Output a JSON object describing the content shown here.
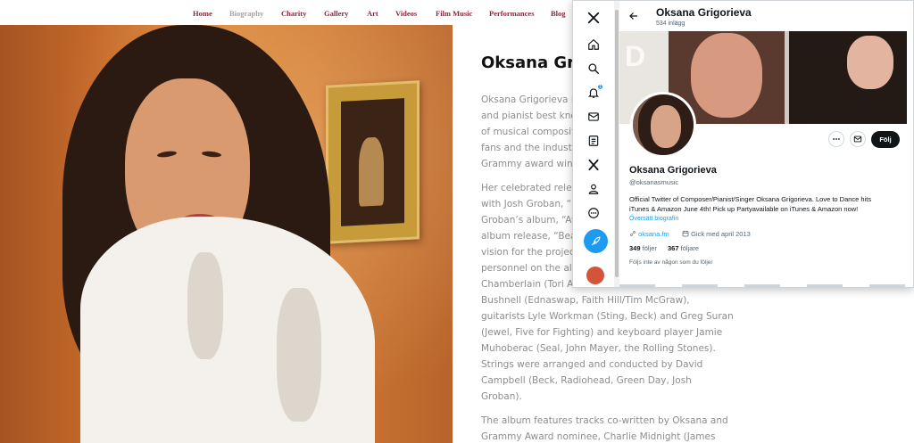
{
  "site_nav": {
    "items": [
      {
        "label": "Home"
      },
      {
        "label": "Biography"
      },
      {
        "label": "Charity"
      },
      {
        "label": "Gallery"
      },
      {
        "label": "Art"
      },
      {
        "label": "Videos"
      },
      {
        "label": "Film Music"
      },
      {
        "label": "Performances"
      },
      {
        "label": "Blog"
      }
    ]
  },
  "article": {
    "title": "Oksana Grig",
    "lines": [
      "Oksana Grigorieva is",
      "and pianist best know",
      "of musical compositio",
      "fans and the industry",
      "Grammy award winni",
      "Her celebrated relea",
      "with Josh Groban, “u",
      "Groban’s album, “Awa",
      "album release, “Beau",
      "vision for the project,",
      "personnel on the albu",
      "Chamberlain (Tori Am",
      "Bushnell (Ednaswap, Faith Hill/Tim McGraw),",
      "guitarists Lyle Workman (Sting, Beck) and Greg Suran",
      "(Jewel, Five for Fighting) and keyboard player Jamie",
      "Muhoberac (Seal, John Mayer, the Rolling Stones).",
      "Strings were arranged and conducted by David",
      "Campbell (Beck, Radiohead, Green Day, Josh",
      "Groban).",
      "The album features tracks co-written by Oksana and",
      "Grammy Award nominee, Charlie Midnight (James"
    ]
  },
  "x_window": {
    "sidebar": {
      "icons": [
        "x-logo-icon",
        "home-icon",
        "search-icon",
        "notifications-icon",
        "messages-icon",
        "lists-icon",
        "premium-x-icon",
        "profile-icon",
        "more-icon"
      ],
      "notification_count": "1",
      "post_button_icon": "feather-icon",
      "accent": "#1d9bf0"
    },
    "header": {
      "name": "Oksana Grigorieva",
      "post_count": "534 inlägg"
    },
    "profile": {
      "name": "Oksana Grigorieva",
      "handle": "@oksanasmusic",
      "bio_line1": "Official Twitter of Composer/Pianist/Singer Oksana Grigorieva. Love to Dance hits",
      "bio_line2": "iTunes & Amazon June 4th! Pick up Partyavailable on iTunes & Amazon now!",
      "translate": "Översätt biografin",
      "website": "oksana.fm",
      "joined": "Gick med april 2013",
      "following_count": "349",
      "following_label": "följer",
      "followers_count": "367",
      "followers_label": "följare",
      "not_followed": "Följs inte av någon som du följer",
      "follow_button": "Följ"
    }
  }
}
